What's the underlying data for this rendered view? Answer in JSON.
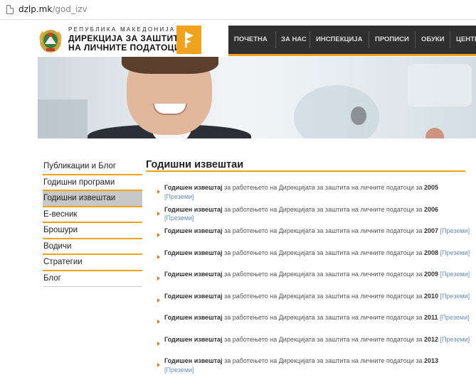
{
  "browser": {
    "url_host": "dzlp.mk",
    "url_path": "/god_izv"
  },
  "header": {
    "org_line1": "РЕПУБЛИКА МАКЕДОНИЈА",
    "org_line2": "ДИРЕКЦИЈА ЗА ЗАШТИТА",
    "org_line3": "НА ЛИЧНИТЕ ПОДАТОЦИ",
    "emblem_icon": "coat-of-arms-icon",
    "logo_icon": "flag-logo-icon",
    "accent_color": "#f1a31e",
    "nav": [
      {
        "label": "ПОЧЕТНА"
      },
      {
        "label": "ЗА НАС"
      },
      {
        "label": "ИНСПЕКЦИЈА"
      },
      {
        "label": "ПРОПИСИ"
      },
      {
        "label": "ОБУКИ"
      },
      {
        "label": "ЦЕНТР"
      }
    ]
  },
  "sidebar": {
    "items": [
      {
        "label": "Публикации и Блог"
      },
      {
        "label": "Годишни програми"
      },
      {
        "label": "Годишни извештаи",
        "active": true
      },
      {
        "label": "Е-весник"
      },
      {
        "label": "Брошури"
      },
      {
        "label": "Водичи"
      },
      {
        "label": "Стратегии"
      },
      {
        "label": "Блог"
      }
    ]
  },
  "main": {
    "title": "Годишни извештаи",
    "reports": [
      {
        "bold": "Годишен извештај",
        "text": " за работењето на Дирекцијата за заштита на личните податоци за ",
        "year": "2005",
        "download": "[Преземи]"
      },
      {
        "bold": "Годишен извештај",
        "text": " за работењето на Дирекцијата за заштита на личните податоци за ",
        "year": "2006",
        "download": "[Преземи]"
      },
      {
        "bold": "Годишен извештај",
        "text": " за работењето на Дирекцијата за заштита на личните податоци за ",
        "year": "2007",
        "download": "[Преземи]"
      },
      {
        "bold": "Годишен извештај",
        "text": " за работењето на Дирекцијата за заштита на личните податоци за ",
        "year": "2008",
        "download": "[Преземи]"
      },
      {
        "bold": "Годишен извештај",
        "text": " за работењето на Дирекцијата за заштита на личните податоци за ",
        "year": "2009",
        "download": "[Преземи]"
      },
      {
        "bold": "Годишен извештај",
        "text": " за работењето на Дирекцијата за заштита на личните податоци за ",
        "year": "2010",
        "download": "[Преземи]"
      },
      {
        "bold": "Годишен извештај",
        "text": " за работењето на Дирекцијата за заштита на личните податоци за ",
        "year": "2011",
        "download": "[Преземи]"
      },
      {
        "bold": "Годишен извештај",
        "text": " за работењето на Дирекцијата за заштита на личните податоци за ",
        "year": "2012",
        "download": "[Преземи]"
      },
      {
        "bold": "Годишен извештај",
        "text": " за работењето на Дирекцијата за заштита на личните податоци за ",
        "year": "2013",
        "download": "[Преземи]"
      }
    ]
  }
}
